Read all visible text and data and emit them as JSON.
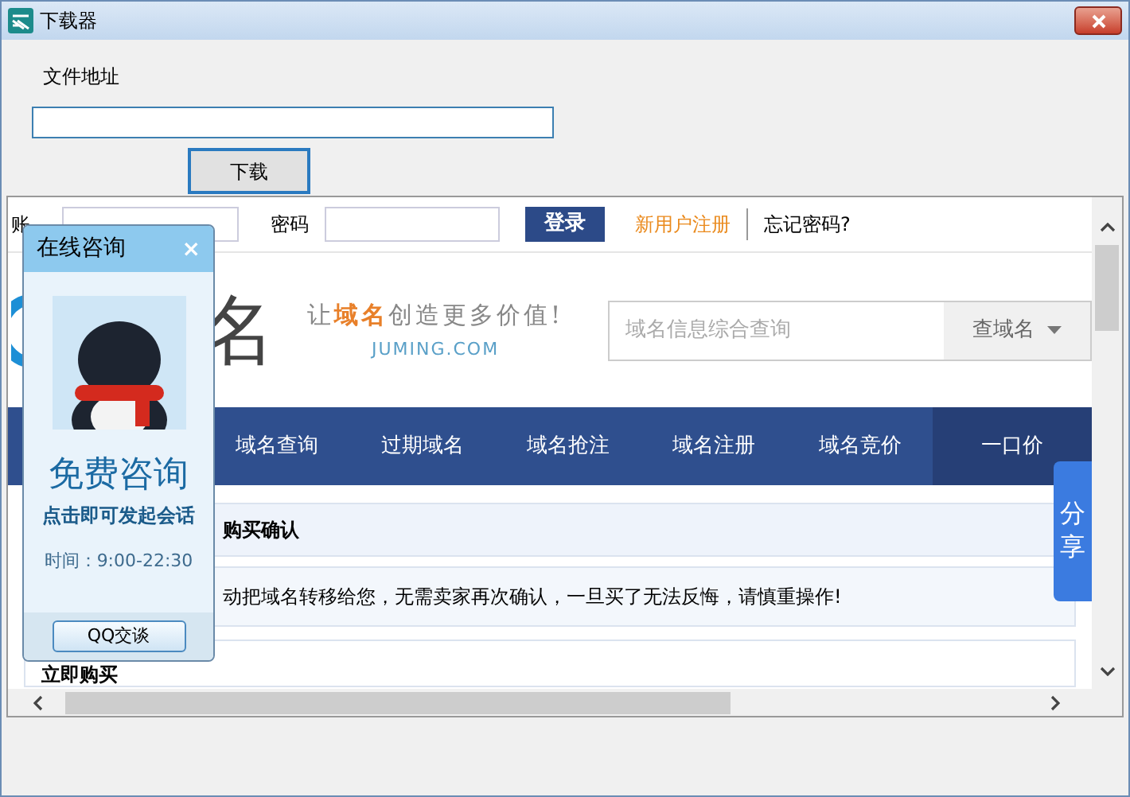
{
  "window": {
    "title": "下载器"
  },
  "form": {
    "label": "文件地址",
    "download_button": "下载"
  },
  "web": {
    "top_bar": {
      "account_label": "账",
      "password_label": "密码",
      "login_button": "登录",
      "register_link": "新用户注册",
      "forgot_link": "忘记密码?"
    },
    "logo": {
      "text": "名",
      "slogan_parts": [
        {
          "text": "让",
          "accent": false
        },
        {
          "text": "域名",
          "accent": true
        },
        {
          "text": "创造更多价值!",
          "accent": false
        }
      ],
      "domain": "JUMING.COM"
    },
    "search": {
      "placeholder": "域名信息综合查询",
      "type_button": "查域名"
    },
    "nav": [
      {
        "label": "域名查询",
        "selected": false
      },
      {
        "label": "过期域名",
        "selected": false
      },
      {
        "label": "域名抢注",
        "selected": false
      },
      {
        "label": "域名注册",
        "selected": false
      },
      {
        "label": "域名竞价",
        "selected": false
      },
      {
        "label": "一口价",
        "selected": true
      }
    ],
    "panel_title": "购买确认",
    "notice": "动把域名转移给您，无需卖家再次确认，一旦买了无法反悔，请慎重操作!",
    "section_title": "立即购买",
    "share_tab": "分享",
    "chat_popup": {
      "title": "在线咨询",
      "close": "×",
      "headline": "免费咨询",
      "subline": "点击即可发起会话",
      "hours": "时间：9:00-22:30",
      "chat_button": "QQ交谈"
    }
  }
}
